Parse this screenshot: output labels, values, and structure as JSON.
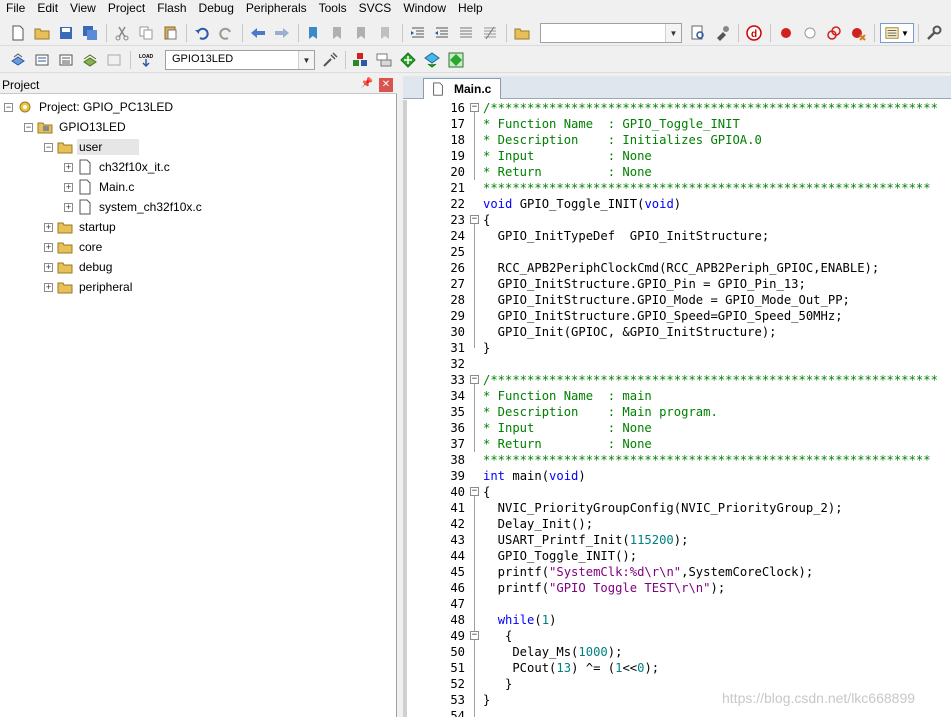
{
  "menubar": {
    "items": [
      "File",
      "Edit",
      "View",
      "Project",
      "Flash",
      "Debug",
      "Peripherals",
      "Tools",
      "SVCS",
      "Window",
      "Help"
    ]
  },
  "toolbar2": {
    "target_combo": "GPIO13LED"
  },
  "project_panel": {
    "title": "Project",
    "tree": {
      "project": "Project: GPIO_PC13LED",
      "target": "GPIO13LED",
      "groups": {
        "user": "user",
        "user_files": [
          "ch32f10x_it.c",
          "Main.c",
          "system_ch32f10x.c"
        ],
        "others": [
          "startup",
          "core",
          "debug",
          "peripheral"
        ]
      }
    }
  },
  "editor": {
    "active_tab": "Main.c",
    "line_numbers": [
      "16",
      "17",
      "18",
      "19",
      "20",
      "21",
      "22",
      "23",
      "24",
      "25",
      "26",
      "27",
      "28",
      "29",
      "30",
      "31",
      "32",
      "33",
      "34",
      "35",
      "36",
      "37",
      "38",
      "39",
      "40",
      "41",
      "42",
      "43",
      "44",
      "45",
      "46",
      "47",
      "48",
      "49",
      "50",
      "51",
      "52",
      "53",
      "54"
    ],
    "lines": {
      "l16": "/*************************************************************",
      "l17": "* Function Name  : GPIO_Toggle_INIT",
      "l18": "* Description    : Initializes GPIOA.0",
      "l19": "* Input          : None",
      "l20": "* Return         : None",
      "l21": "*************************************************************",
      "l22a": "void",
      "l22b": " GPIO_Toggle_INIT(",
      "l22c": "void",
      "l22d": ")",
      "l23": "{",
      "l24": "  GPIO_InitTypeDef  GPIO_InitStructure;",
      "l26": "  RCC_APB2PeriphClockCmd(RCC_APB2Periph_GPIOC,ENABLE);",
      "l27": "  GPIO_InitStructure.GPIO_Pin = GPIO_Pin_13;",
      "l28": "  GPIO_InitStructure.GPIO_Mode = GPIO_Mode_Out_PP;",
      "l29": "  GPIO_InitStructure.GPIO_Speed=GPIO_Speed_50MHz;",
      "l30": "  GPIO_Init(GPIOC, &GPIO_InitStructure);",
      "l31": "}",
      "l33": "/*************************************************************",
      "l34": "* Function Name  : main",
      "l35": "* Description    : Main program.",
      "l36": "* Input          : None",
      "l37": "* Return         : None",
      "l38": "*************************************************************",
      "l39a": "int",
      "l39b": " main(",
      "l39c": "void",
      "l39d": ")",
      "l40": "{",
      "l41": "  NVIC_PriorityGroupConfig(NVIC_PriorityGroup_2);",
      "l42": "  Delay_Init();",
      "l43a": "  USART_Printf_Init(",
      "l43b": "115200",
      "l43c": ");",
      "l44": "  GPIO_Toggle_INIT();",
      "l45a": "  printf(",
      "l45b": "\"SystemClk:%d\\r\\n\"",
      "l45c": ",SystemCoreClock);",
      "l46a": "  printf(",
      "l46b": "\"GPIO Toggle TEST\\r\\n\"",
      "l46c": ");",
      "l48a": "  ",
      "l48b": "while",
      "l48c": "(",
      "l48d": "1",
      "l48e": ")",
      "l49": "   {",
      "l50a": "    Delay_Ms(",
      "l50b": "1000",
      "l50c": ");",
      "l51a": "    PCout(",
      "l51b": "13",
      "l51c": ") ^= (",
      "l51d": "1",
      "l51e": "<<",
      "l51f": "0",
      "l51g": ");",
      "l52": "   }",
      "l53": "}"
    }
  },
  "watermark": "https://blog.csdn.net/lkc668899",
  "colors": {
    "comment": "#008000",
    "keyword": "#0000ff",
    "string": "#800080",
    "number": "#008080",
    "tab_bar": "#dfe6ee",
    "close_red": "#d9534f"
  }
}
